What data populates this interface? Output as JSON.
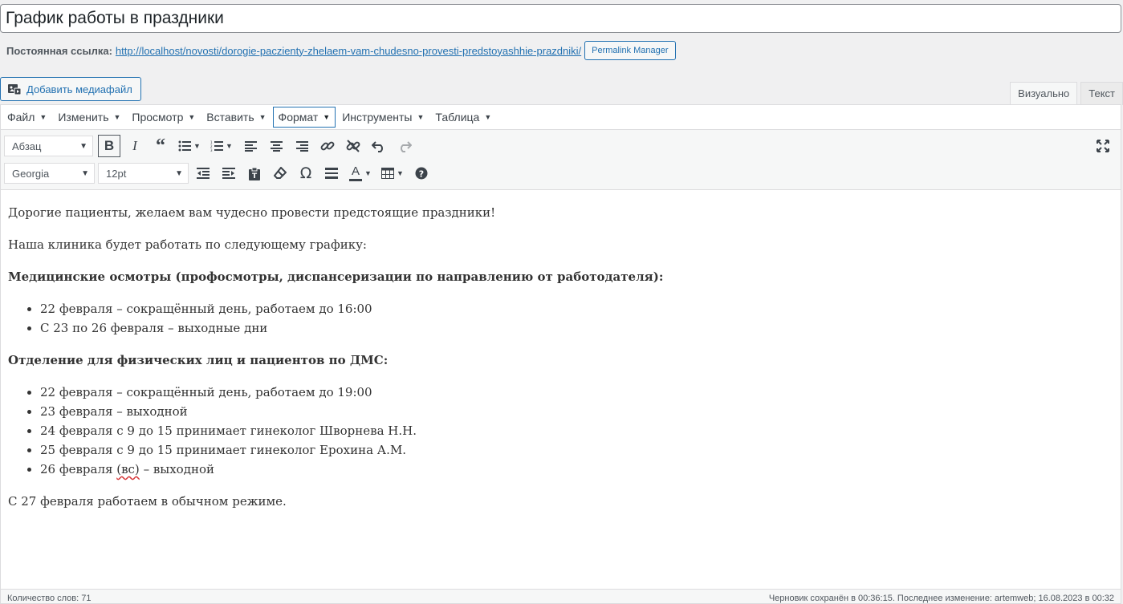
{
  "post": {
    "title": "График работы в праздники",
    "permalink_label": "Постоянная ссылка:",
    "permalink_url": "http://localhost/novosti/dorogie-paczienty-zhelaem-vam-chudesno-provesti-predstoyashhie-prazdniki/",
    "permalink_manager_label": "Permalink Manager"
  },
  "media": {
    "add_label": "Добавить медиафайл",
    "icon": "media-icon"
  },
  "tabs": [
    {
      "label": "Визуально",
      "active": true
    },
    {
      "label": "Текст",
      "active": false
    }
  ],
  "menubar": [
    {
      "label": "Файл"
    },
    {
      "label": "Изменить"
    },
    {
      "label": "Просмотр"
    },
    {
      "label": "Вставить"
    },
    {
      "label": "Формат",
      "active": true
    },
    {
      "label": "Инструменты"
    },
    {
      "label": "Таблица"
    }
  ],
  "toolbar": {
    "paragraph_format": "Абзац",
    "font_family": "Georgia",
    "font_size": "12pt",
    "icons_row1": [
      "bold-icon",
      "italic-icon",
      "blockquote-icon",
      "bullet-list-icon",
      "numbered-list-icon",
      "align-left-icon",
      "align-center-icon",
      "align-right-icon",
      "link-icon",
      "unlink-icon",
      "undo-icon",
      "redo-icon",
      "fullscreen-icon"
    ],
    "icons_row2": [
      "outdent-icon",
      "indent-icon",
      "paste-text-icon",
      "clear-formatting-icon",
      "special-char-icon",
      "horizontal-line-icon",
      "text-color-icon",
      "table-icon",
      "help-icon"
    ]
  },
  "content": {
    "p1": "Дорогие пациенты, желаем вам чудесно провести предстоящие праздники!",
    "p2": "Наша клиника будет работать по следующему графику:",
    "h1": "Медицинские осмотры (профосмотры, диспансеризации по направлению от работодателя):",
    "list1": [
      "22 февраля – сокращённый день, работаем до 16:00",
      "С 23 по 26 февраля – выходные дни"
    ],
    "h2": "Отделение для физических лиц и пациентов по ДМС:",
    "list2": [
      "22 февраля – сокращённый день, работаем до 19:00",
      "23 февраля – выходной",
      "24 февраля с 9 до 15 принимает гинеколог Шворнева Н.Н.",
      "25 февраля с 9 до 15 принимает гинеколог Ерохина А.М."
    ],
    "list2_last_prefix": "26 февраля ",
    "list2_last_marked": "(вс)",
    "list2_last_suffix": " – выходной",
    "p3": "С 27 февраля работаем в обычном режиме."
  },
  "status": {
    "word_count": "Количество слов: 71",
    "saved": "Черновик сохранён в 00:36:15. Последнее изменение: artemweb; 16.08.2023 в 00:32"
  }
}
